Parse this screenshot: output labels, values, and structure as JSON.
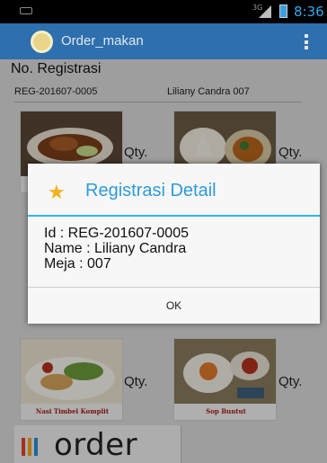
{
  "status_bar": {
    "signal_label": "3G",
    "time": "8:36",
    "icons": [
      "notification-icon",
      "signal-icon",
      "battery-icon"
    ]
  },
  "action_bar": {
    "title": "Order_makan",
    "icons": [
      "app-logo-icon",
      "overflow-menu-icon"
    ]
  },
  "registration": {
    "heading": "No. Registrasi",
    "id": "REG-201607-0005",
    "name_table": "Liliany Candra 007"
  },
  "menu_items": [
    {
      "name": "",
      "qty_label": "Qty."
    },
    {
      "name": "",
      "qty_label": "Qty."
    },
    {
      "name": "Nasi Timbel Komplit",
      "qty_label": "Qty."
    },
    {
      "name": "Sop Buntut",
      "qty_label": "Qty."
    }
  ],
  "order_logo": {
    "text": "order"
  },
  "dialog": {
    "title": "Registrasi Detail",
    "icon": "star-icon",
    "line_id": "Id : REG-201607-0005",
    "line_name": "Name : Liliany Candra",
    "line_meja": "Meja : 007",
    "ok_label": "OK"
  },
  "colors": {
    "action_bar": "#2e6fae",
    "dialog_title": "#2f9bd6",
    "dialog_divider": "#33b1f0",
    "status_time": "#39a8e8"
  }
}
